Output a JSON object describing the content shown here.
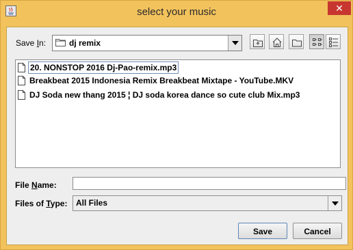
{
  "window": {
    "title": "select your music",
    "close_glyph": "✕"
  },
  "save_in": {
    "label_prefix": "Save ",
    "label_mnemonic": "I",
    "label_suffix": "n:",
    "value": "dj remix"
  },
  "toolbar": {
    "buttons": [
      "up-one-level-icon",
      "home-icon",
      "new-folder-icon",
      "list-view-icon",
      "details-view-icon"
    ]
  },
  "files": [
    {
      "name": "20. NONSTOP 2016 Dj-Pao-remix.mp3",
      "selected": true
    },
    {
      "name": "Breakbeat 2015 Indonesia Remix Breakbeat Mixtape - YouTube.MKV",
      "selected": false
    },
    {
      "name": "DJ Soda new thang 2015 ¦ DJ soda korea dance so cute club Mix.mp3",
      "selected": false
    }
  ],
  "file_name": {
    "label_prefix": "File ",
    "label_mnemonic": "N",
    "label_suffix": "ame:",
    "value": ""
  },
  "file_type": {
    "label_prefix": "Files of ",
    "label_mnemonic": "T",
    "label_suffix": "ype:",
    "value": "All Files"
  },
  "buttons": {
    "save": "Save",
    "cancel": "Cancel"
  },
  "colors": {
    "titlebar": "#f2c25c",
    "close_button": "#c7372f",
    "dialog_background": "#eeeeee"
  }
}
